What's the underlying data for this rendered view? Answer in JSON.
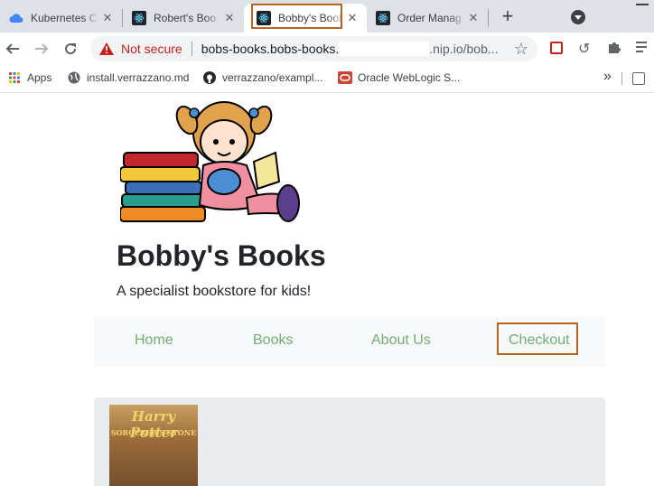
{
  "browser": {
    "tabs": [
      {
        "label": "Kubernetes C",
        "icon": "cloud-icon"
      },
      {
        "label": "Robert's Boo",
        "icon": "react-icon"
      },
      {
        "label": "Bobby's Bool",
        "icon": "react-icon",
        "active": true
      },
      {
        "label": "Order Manag",
        "icon": "react-icon"
      }
    ],
    "new_tab_label": "+",
    "security_label": "Not secure",
    "url_prefix": "bobs-books.bobs-books.",
    "url_suffix": ".nip.io/bob...",
    "bookmarks": [
      {
        "label": "Apps",
        "icon": "apps-grid-icon"
      },
      {
        "label": "install.verrazzano.md",
        "icon": "globe-icon"
      },
      {
        "label": "verrazzano/exampl...",
        "icon": "github-icon"
      },
      {
        "label": "Oracle WebLogic S...",
        "icon": "oracle-icon"
      }
    ],
    "more_bookmarks": "»"
  },
  "page": {
    "title": "Bobby's Books",
    "tagline": "A specialist bookstore for kids!",
    "nav": [
      {
        "label": "Home"
      },
      {
        "label": "Books"
      },
      {
        "label": "About Us"
      },
      {
        "label": "Checkout"
      }
    ],
    "book_cover_text": [
      "Harry Potter",
      "SORCERER'S STONE"
    ]
  },
  "colors": {
    "nav_link": "#72ad75",
    "highlight_border": "#b5651d",
    "not_secure": "#c5221f"
  }
}
